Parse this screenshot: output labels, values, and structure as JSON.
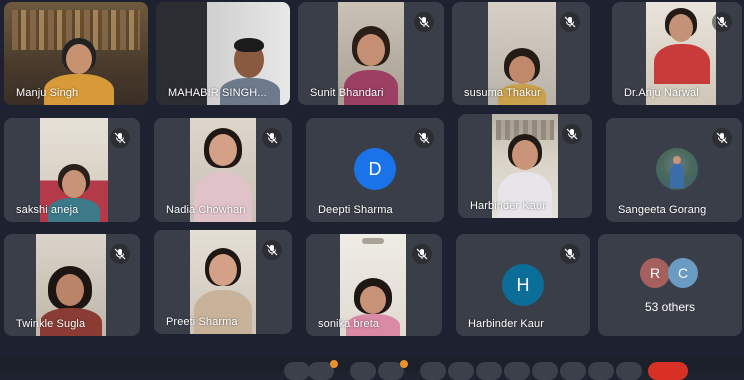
{
  "participants": [
    {
      "name": "Manju Singh",
      "muted": false
    },
    {
      "name": "MAHABIR SINGH...",
      "muted": false
    },
    {
      "name": "Sunit Bhandari",
      "muted": true
    },
    {
      "name": "susuma Thakur",
      "muted": true
    },
    {
      "name": "Dr.Anju Narwal",
      "muted": true
    },
    {
      "name": "sakshi aneja",
      "muted": true
    },
    {
      "name": "Nadia Chowhan",
      "muted": true
    },
    {
      "name": "Deepti Sharma",
      "muted": true,
      "initial": "D",
      "avatar_color": "#1a73e8"
    },
    {
      "name": "Harbinder Kaur",
      "muted": true
    },
    {
      "name": "Sangeeta Gorang",
      "muted": true
    },
    {
      "name": "Twinkle Sugla",
      "muted": true
    },
    {
      "name": "Preeti Sharma",
      "muted": true
    },
    {
      "name": "sonika breta",
      "muted": true
    },
    {
      "name": "Harbinder Kaur",
      "muted": true,
      "initial": "H",
      "avatar_color": "#0b6e99"
    }
  ],
  "others": {
    "label": "53 others",
    "initials": [
      "R",
      "C"
    ],
    "colors": [
      "#a5605e",
      "#6a9bc3"
    ]
  },
  "icons": {
    "mic_off": "mic-off-icon"
  },
  "colors": {
    "background": "#1e2230",
    "tile": "#3a3e48",
    "accent_badge": "#e8912d"
  }
}
